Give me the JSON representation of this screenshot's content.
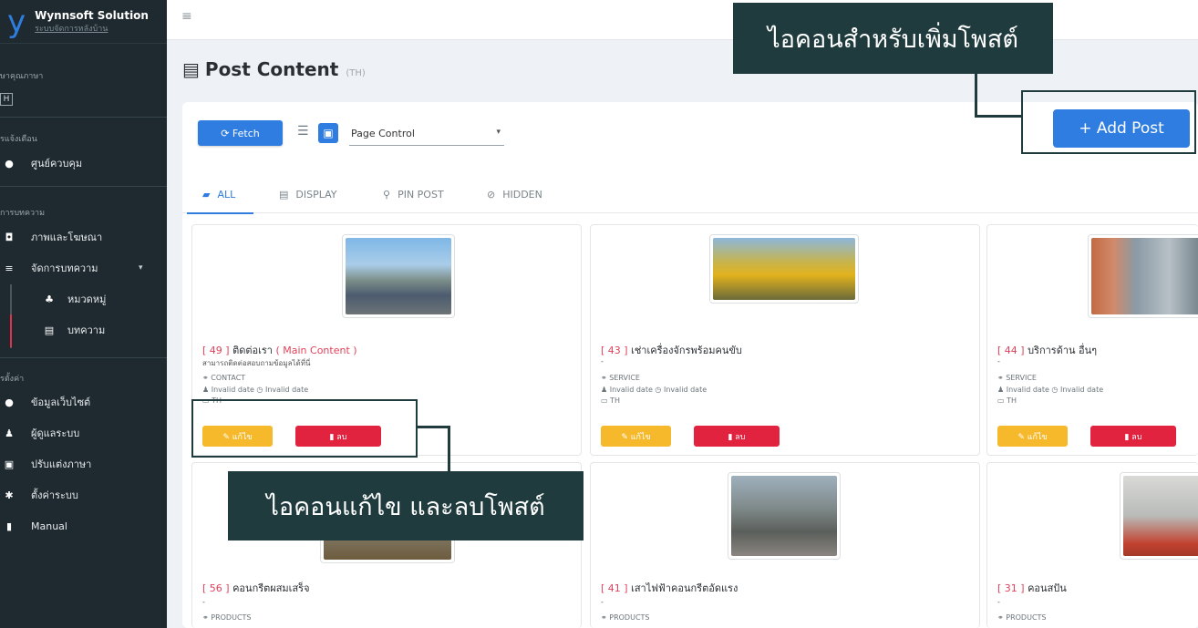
{
  "sidebar": {
    "brand_title": "Wynnsoft Solution",
    "brand_sub": "ระบบจัดการหลังบ้าน",
    "lang_label": "ษาคุณภาษา",
    "lang_value": "H",
    "notify_label": "รแจ้งเตือน",
    "control_center": "ศูนย์ควบคุม",
    "content_label": "การบทความ",
    "images_video": "ภาพและโฆษณา",
    "manage_content": "จัดการบทความ",
    "category": "หมวดหมู่",
    "article": "บทความ",
    "settings_label": "รตั้งค่า",
    "site_info": "ข้อมูลเว็บไซต์",
    "users": "ผู้ดูแลระบบ",
    "language": "ปรับแต่งภาษา",
    "system_settings": "ตั้งค่าระบบ",
    "manual": "Manual"
  },
  "page": {
    "title": "Post Content",
    "lang_tag": "(TH)"
  },
  "toolbar": {
    "fetch_label": "⟳ Fetch",
    "select_value": "Page Control",
    "add_post_label": "+ Add Post"
  },
  "tabs": [
    {
      "label": "ALL"
    },
    {
      "label": "DISPLAY"
    },
    {
      "label": "PIN POST"
    },
    {
      "label": "HIDDEN"
    }
  ],
  "cards": [
    {
      "id_text": "[ 49 ]",
      "title": "ติดต่อเรา",
      "main": "( Main Content )",
      "desc": "สามารถติดต่อสอบถามข้อมูลได้ที่นี่",
      "tag": "CONTACT",
      "dates": "Invalid date  ◷ Invalid date",
      "lang": "TH",
      "edit": "แก้ไข",
      "delete": "ลบ"
    },
    {
      "id_text": "[ 43 ]",
      "title": "เช่าเครื่องจักรพร้อมคนขับ",
      "main": "",
      "desc": "-",
      "tag": "SERVICE",
      "dates": "Invalid date  ◷ Invalid date",
      "lang": "TH",
      "edit": "แก้ไข",
      "delete": "ลบ"
    },
    {
      "id_text": "[ 44 ]",
      "title": "บริการด้าน อื่นๆ",
      "main": "",
      "desc": "-",
      "tag": "SERVICE",
      "dates": "Invalid date  ◷ Invalid date",
      "lang": "TH",
      "edit": "แก้ไข",
      "delete": "ลบ"
    },
    {
      "id_text": "[ 56 ]",
      "title": "คอนกรีตผสมเสร็จ",
      "main": "",
      "desc": "-",
      "tag": "PRODUCTS"
    },
    {
      "id_text": "[ 41 ]",
      "title": "เสาไฟฟ้าคอนกรีตอัดแรง",
      "main": "",
      "desc": "-",
      "tag": "PRODUCTS"
    },
    {
      "id_text": "[ 31 ]",
      "title": "คอนสปัน",
      "main": "",
      "desc": "-",
      "tag": "PRODUCTS"
    }
  ],
  "annotations": {
    "add_icon_caption": "ไอคอนสำหรับเพิ่มโพสต์",
    "edit_delete_caption": "ไอคอนแก้ไข และลบโพสต์"
  }
}
